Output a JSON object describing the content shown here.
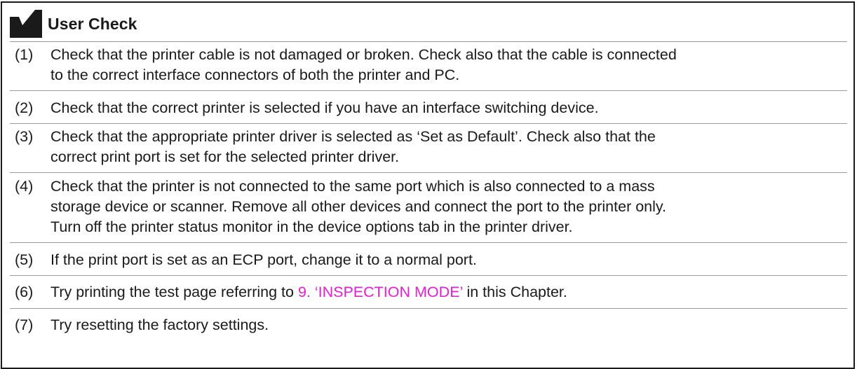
{
  "header": {
    "icon": "checkmark-icon",
    "icon_color": "#1a1a1a",
    "title": "User Check"
  },
  "link_color": "#e81fd2",
  "items": [
    {
      "number": "(1)",
      "lines": [
        "Check that the printer cable is not damaged or broken.  Check also that the cable is connected",
        "to the correct interface connectors of both the printer and PC."
      ]
    },
    {
      "number": "(2)",
      "lines": [
        "Check that the correct printer is selected if you have an interface switching device."
      ]
    },
    {
      "number": "(3)",
      "lines": [
        "Check that the appropriate printer driver is selected as ‘Set as Default’.  Check also that the",
        "correct print port is set for the selected printer driver."
      ]
    },
    {
      "number": "(4)",
      "lines": [
        "Check that the printer is not connected to the same port which is also connected to a mass",
        "storage device or scanner.  Remove all other devices and connect the port to the printer only.",
        "Turn off the printer status monitor in the device options tab in the printer driver."
      ]
    },
    {
      "number": "(5)",
      "lines": [
        "If the print port is set as an ECP port, change it to a normal port."
      ]
    },
    {
      "number": "(6)",
      "text_before": "Try printing the test page referring to ",
      "link_text": "9. ‘INSPECTION MODE’",
      "text_after": " in this Chapter."
    },
    {
      "number": "(7)",
      "lines": [
        "Try resetting the factory settings."
      ]
    }
  ]
}
